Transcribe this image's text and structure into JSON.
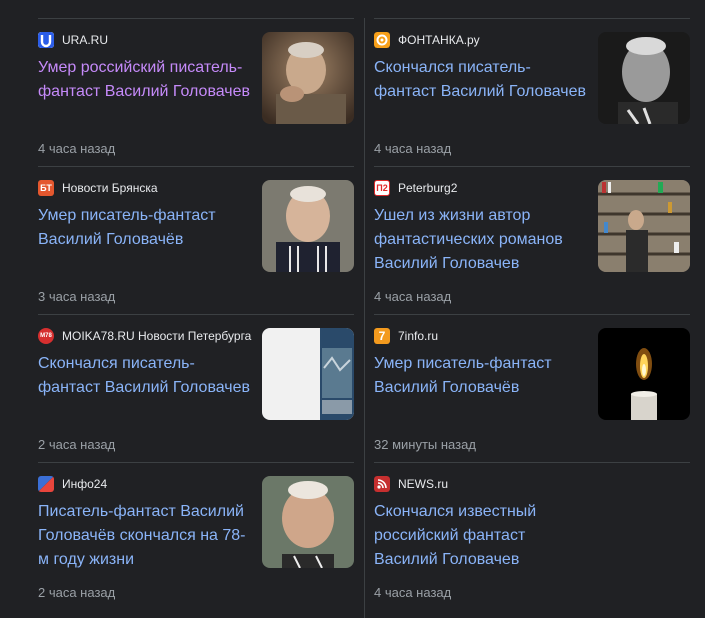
{
  "articles": [
    {
      "source": "URA.RU",
      "title": "Умер российский писатель-фантаст Василий Головачев",
      "time": "4 часа назад",
      "icon": "ura-favicon-icon",
      "icon_text": "",
      "icon_color": "#2b5de8"
    },
    {
      "source": "ФОНТАНКА.ру",
      "title": "Скончался писатель-фантаст Василий Головачев",
      "time": "4 часа назад",
      "icon": "fontanka-favicon-icon",
      "icon_text": "",
      "icon_color": "#f7a01a"
    },
    {
      "source": "Новости Брянска",
      "title": "Умер писатель-фантаст Василий Головачёв",
      "time": "3 часа назад",
      "icon": "novosti-bryanska-favicon-icon",
      "icon_text": "БТ",
      "icon_color": "#e4572e"
    },
    {
      "source": "Peterburg2",
      "title": "Ушел из жизни автор фантастических романов Василий Головачев",
      "time": "4 часа назад",
      "icon": "peterburg2-favicon-icon",
      "icon_text": "П2",
      "icon_color": "#e02a2a"
    },
    {
      "source": "MOIKA78.RU Новости Петербурга",
      "title": "Скончался писатель-фантаст Василий Головачев",
      "time": "2 часа назад",
      "icon": "moika78-favicon-icon",
      "icon_text": "M78",
      "icon_color": "#d62f2f"
    },
    {
      "source": "7info.ru",
      "title": "Умер писатель-фантаст Василий Головачёв",
      "time": "32 минуты назад",
      "icon": "7info-favicon-icon",
      "icon_text": "7",
      "icon_color": "#f39a1e"
    },
    {
      "source": "Инфо24",
      "title": "Писатель-фантаст Василий Головачёв скончался на 78-м году жизни",
      "time": "2 часа назад",
      "icon": "info24-favicon-icon",
      "icon_text": "",
      "icon_color": "#e8453c"
    },
    {
      "source": "NEWS.ru",
      "title": "Скончался известный российский фантаст Василий Головачев",
      "time": "4 часа назад",
      "icon": "newsru-favicon-icon",
      "icon_text": "",
      "icon_color": "#c62f2f"
    }
  ],
  "colors": {
    "background": "#202124",
    "link": "#8ab4f8",
    "visited_link": "#c58af9",
    "divider": "#3c4043",
    "muted_text": "#9aa0a6"
  }
}
